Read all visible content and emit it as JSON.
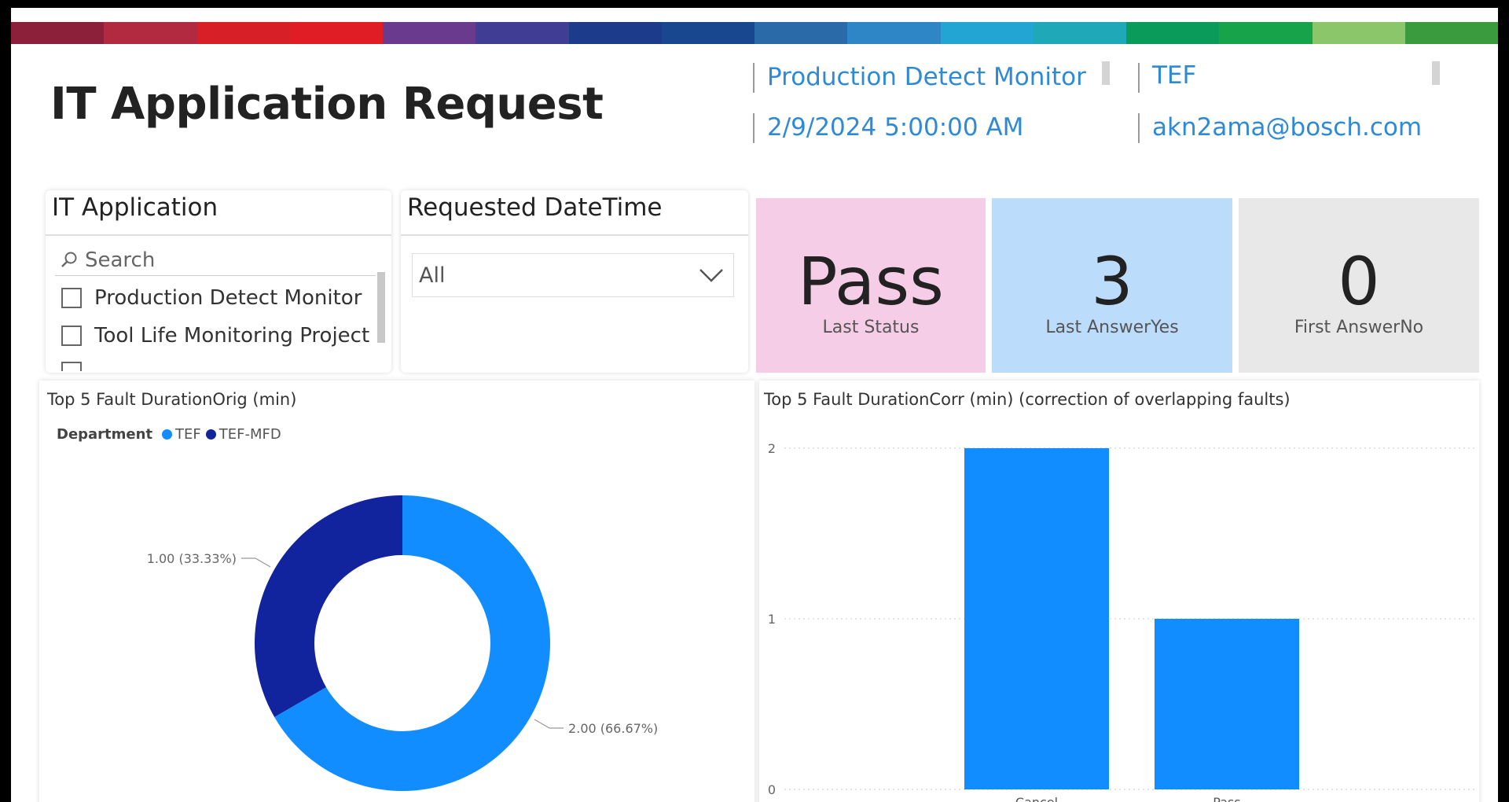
{
  "header": {
    "title": "IT Application Request",
    "application": "Production Detect Monitor",
    "department": "TEF",
    "datetime": "2/9/2024 5:00:00 AM",
    "email": "akn2ama@bosch.com"
  },
  "brand_colors": [
    "#8c1f3a",
    "#b22a40",
    "#d61f26",
    "#e01d24",
    "#6a3a8e",
    "#3f3d94",
    "#1c3b8a",
    "#18478f",
    "#2b6aa8",
    "#2f86c6",
    "#23a5d4",
    "#1fa9b8",
    "#0a9a5a",
    "#16a34a",
    "#8bc66b",
    "#3a9a3e"
  ],
  "slicer_app": {
    "title": "IT Application",
    "search_placeholder": "Search",
    "options": [
      "Production Detect Monitor",
      "Tool Life Monitoring Project"
    ]
  },
  "slicer_date": {
    "title": "Requested DateTime",
    "selected": "All"
  },
  "kpis": [
    {
      "value": "Pass",
      "label": "Last Status",
      "color": "#f6cde6"
    },
    {
      "value": "3",
      "label": "Last AnswerYes",
      "color": "#bcdcfb"
    },
    {
      "value": "0",
      "label": "First AnswerNo",
      "color": "#e8e8e8"
    }
  ],
  "chart_data": [
    {
      "type": "pie",
      "title": "Top 5 Fault DurationOrig (min)",
      "legend_title": "Department",
      "categories": [
        "TEF",
        "TEF-MFD"
      ],
      "values": [
        2,
        1
      ],
      "colors": [
        "#118dff",
        "#12239e"
      ],
      "data_labels": [
        "2.00 (66.67%)",
        "1.00 (33.33%)"
      ],
      "legend": "top-left"
    },
    {
      "type": "bar",
      "title": "Top 5 Fault DurationCorr (min) (correction of overlapping faults)",
      "categories": [
        "Cancel",
        "Pass"
      ],
      "values": [
        2,
        1
      ],
      "ylim": [
        0,
        2
      ],
      "yticks": [
        "0",
        "1",
        "2"
      ],
      "color": "#118dff",
      "grid": true
    }
  ]
}
